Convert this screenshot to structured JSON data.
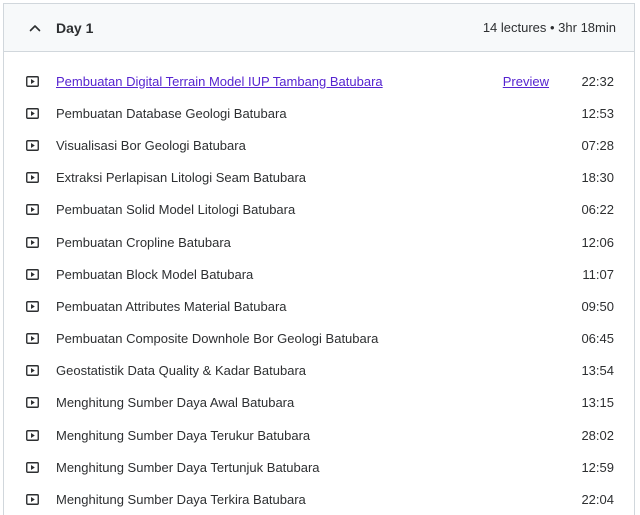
{
  "section": {
    "title": "Day 1",
    "meta": "14 lectures • 3hr 18min",
    "icon": "chevron-up-icon"
  },
  "lectures": [
    {
      "title": "Pembuatan Digital Terrain Model IUP Tambang Batubara",
      "preview": "Preview",
      "duration": "22:32"
    },
    {
      "title": "Pembuatan Database Geologi Batubara",
      "duration": "12:53"
    },
    {
      "title": "Visualisasi Bor Geologi Batubara",
      "duration": "07:28"
    },
    {
      "title": "Extraksi Perlapisan Litologi Seam Batubara",
      "duration": "18:30"
    },
    {
      "title": "Pembuatan Solid Model Litologi Batubara",
      "duration": "06:22"
    },
    {
      "title": "Pembuatan Cropline Batubara",
      "duration": "12:06"
    },
    {
      "title": "Pembuatan Block Model Batubara",
      "duration": "11:07"
    },
    {
      "title": "Pembuatan Attributes Material Batubara",
      "duration": "09:50"
    },
    {
      "title": "Pembuatan Composite Downhole Bor Geologi Batubara",
      "duration": "06:45"
    },
    {
      "title": "Geostatistik Data Quality & Kadar Batubara",
      "duration": "13:54"
    },
    {
      "title": "Menghitung Sumber Daya Awal Batubara",
      "duration": "13:15"
    },
    {
      "title": "Menghitung Sumber Daya Terukur Batubara",
      "duration": "28:02"
    },
    {
      "title": "Menghitung Sumber Daya Tertunjuk Batubara",
      "duration": "12:59"
    },
    {
      "title": "Menghitung Sumber Daya Terkira Batubara",
      "duration": "22:04"
    }
  ],
  "icons": {
    "lecture": "video-play-icon"
  },
  "colors": {
    "link": "#5624d0",
    "text": "#2d2f31",
    "header_bg": "#f7f9fa",
    "border": "#d1d7dc"
  }
}
